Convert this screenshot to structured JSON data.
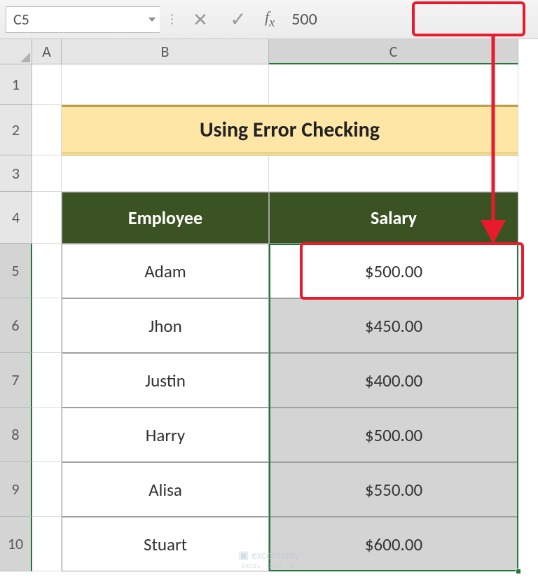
{
  "formula_bar": {
    "name_box": "C5",
    "formula_value": "500"
  },
  "columns": [
    "A",
    "B",
    "C"
  ],
  "row_numbers": [
    "1",
    "2",
    "3",
    "4",
    "5",
    "6",
    "7",
    "8",
    "9",
    "10"
  ],
  "title": "Using Error Checking",
  "table": {
    "headers": {
      "employee": "Employee",
      "salary": "Salary"
    },
    "rows": [
      {
        "employee": "Adam",
        "salary": "$500.00"
      },
      {
        "employee": "Jhon",
        "salary": "$450.00"
      },
      {
        "employee": "Justin",
        "salary": "$400.00"
      },
      {
        "employee": "Harry",
        "salary": "$500.00"
      },
      {
        "employee": "Alisa",
        "salary": "$550.00"
      },
      {
        "employee": "Stuart",
        "salary": "$600.00"
      }
    ]
  },
  "active_cell": "C5",
  "row_heights": {
    "r1": 58,
    "r2": 72,
    "r3": 52,
    "r4": 74,
    "r5": 78,
    "r6": 78,
    "r7": 78,
    "r8": 78,
    "r9": 78,
    "r10": 78
  },
  "chart_data": {
    "type": "table",
    "title": "Using Error Checking",
    "columns": [
      "Employee",
      "Salary"
    ],
    "rows": [
      [
        "Adam",
        500.0
      ],
      [
        "Jhon",
        450.0
      ],
      [
        "Justin",
        400.0
      ],
      [
        "Harry",
        500.0
      ],
      [
        "Alisa",
        550.0
      ],
      [
        "Stuart",
        600.0
      ]
    ]
  },
  "watermark": {
    "name": "exceldemy",
    "sub": "EXCEL · DATA · BI"
  }
}
